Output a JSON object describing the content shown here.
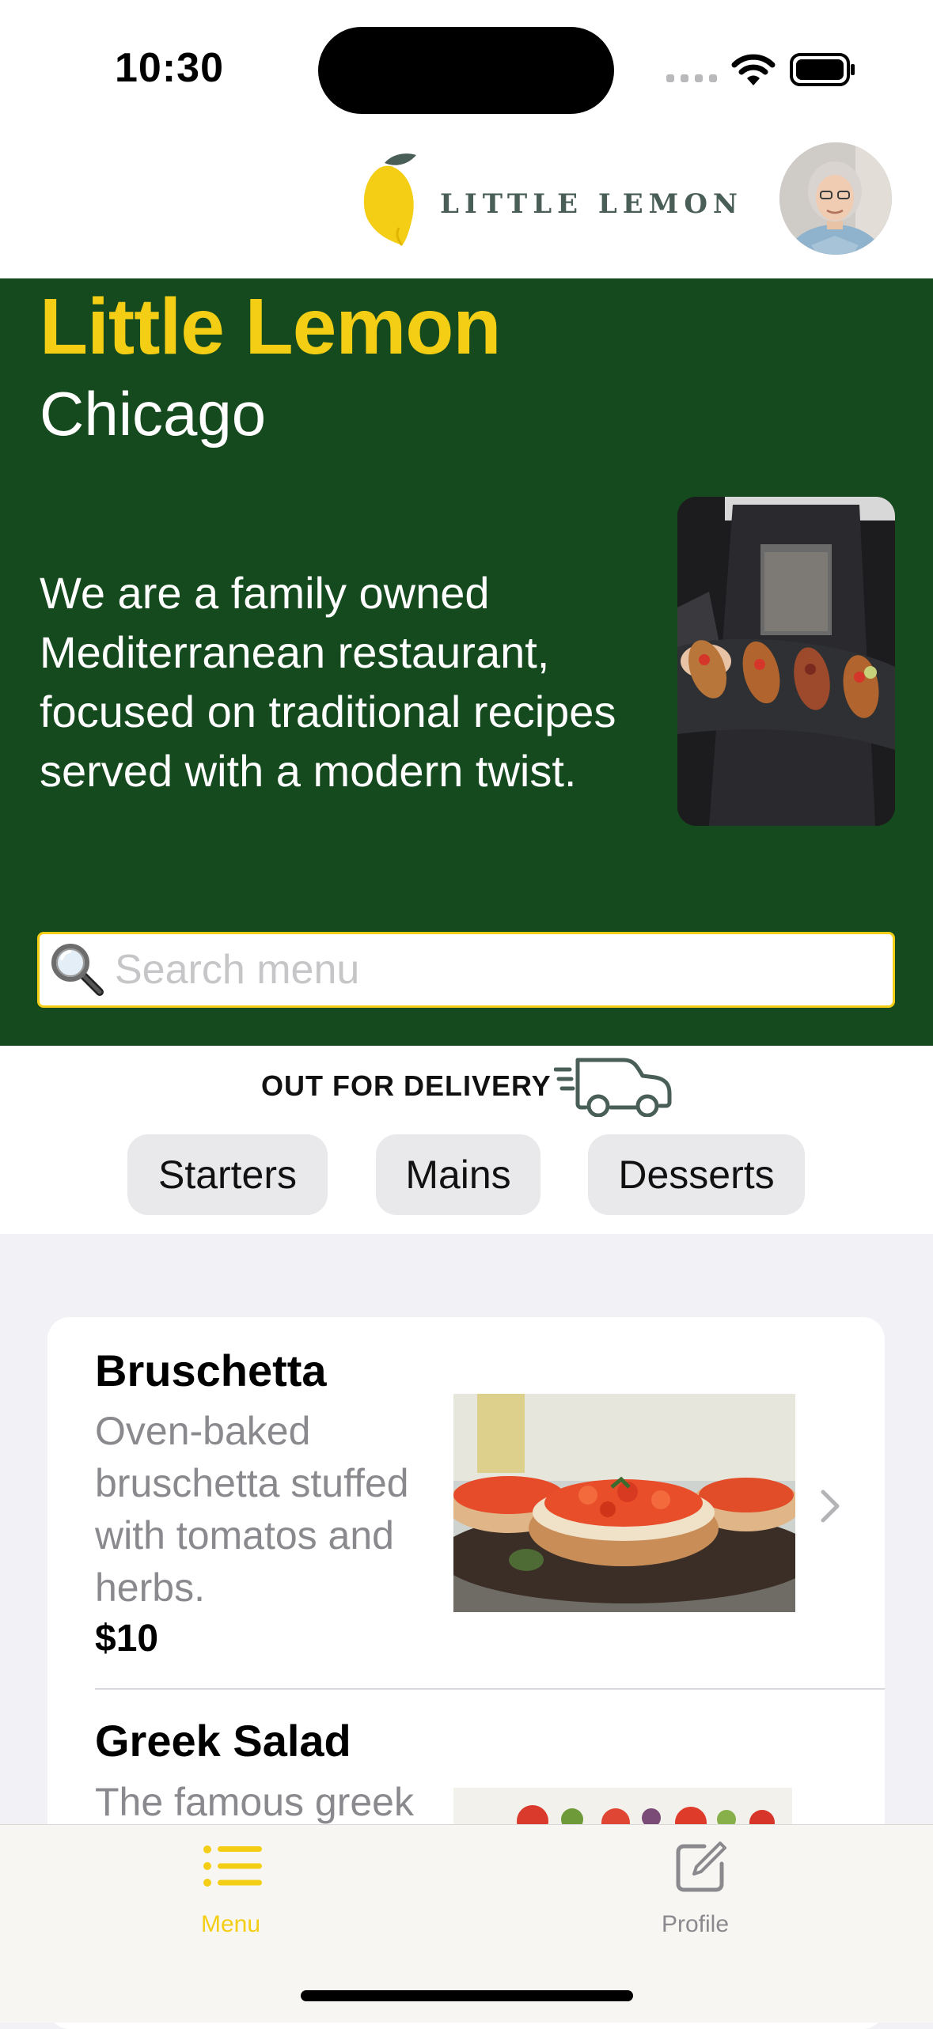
{
  "status_bar": {
    "time": "10:30"
  },
  "header": {
    "logo_text": "LITTLE LEMON"
  },
  "hero": {
    "title": "Little Lemon",
    "city": "Chicago",
    "description": "We are a family owned Mediterranean restaurant, focused on traditional recipes served with a modern twist."
  },
  "search": {
    "placeholder": "Search menu",
    "value": ""
  },
  "delivery": {
    "label": "OUT FOR DELIVERY"
  },
  "categories": [
    {
      "label": "Starters"
    },
    {
      "label": "Mains"
    },
    {
      "label": "Desserts"
    }
  ],
  "menu_items": [
    {
      "name": "Bruschetta",
      "description": "Oven-baked bruschetta stuffed with tomatos and herbs.",
      "price": "$10"
    },
    {
      "name": "Greek Salad",
      "description": "The famous greek"
    }
  ],
  "tab_bar": {
    "items": [
      {
        "label": "Menu",
        "icon": "list-icon",
        "active": true
      },
      {
        "label": "Profile",
        "icon": "edit-icon",
        "active": false
      }
    ]
  },
  "colors": {
    "primary_green": "#154a1e",
    "accent_yellow": "#f4ce14",
    "logo_green": "#495e57",
    "inactive_gray": "#8a8a8e"
  }
}
